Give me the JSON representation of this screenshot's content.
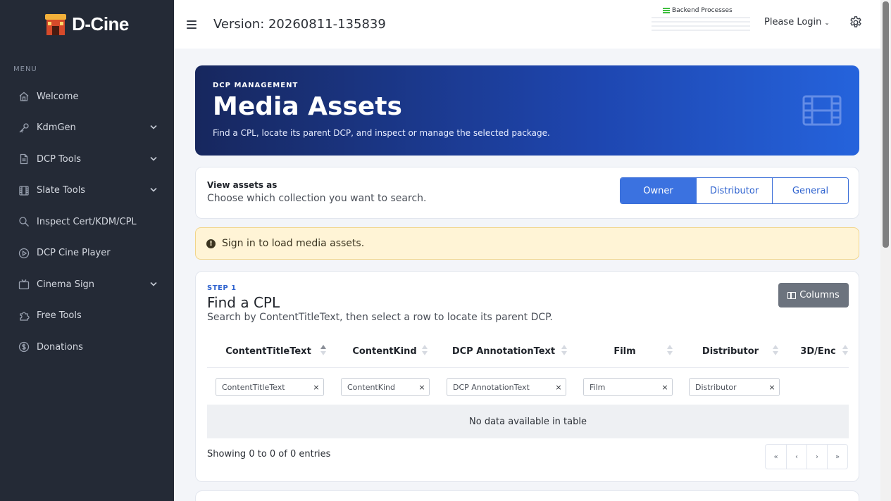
{
  "brand": {
    "name": "D-Cine"
  },
  "sidebar": {
    "menu_label": "MENU",
    "items": [
      {
        "label": "Welcome",
        "icon": "home-icon",
        "has_submenu": false
      },
      {
        "label": "KdmGen",
        "icon": "key-icon",
        "has_submenu": true
      },
      {
        "label": "DCP Tools",
        "icon": "file-icon",
        "has_submenu": true
      },
      {
        "label": "Slate Tools",
        "icon": "film-icon",
        "has_submenu": true
      },
      {
        "label": "Inspect Cert/KDM/CPL",
        "icon": "search-icon",
        "has_submenu": false
      },
      {
        "label": "DCP Cine Player",
        "icon": "play-icon",
        "has_submenu": false
      },
      {
        "label": "Cinema Sign",
        "icon": "tv-icon",
        "has_submenu": true
      },
      {
        "label": "Free Tools",
        "icon": "puzzle-icon",
        "has_submenu": false
      },
      {
        "label": "Donations",
        "icon": "dollar-icon",
        "has_submenu": false
      }
    ]
  },
  "header": {
    "version": "Version: 20260811-135839",
    "backend_label": "Backend Processes",
    "login_label": "Please Login",
    "login_caret": "⌄"
  },
  "hero": {
    "eyebrow": "DCP MANAGEMENT",
    "title": "Media Assets",
    "subtitle": "Find a CPL, locate its parent DCP, and inspect or manage the selected package."
  },
  "view": {
    "heading": "View assets as",
    "description": "Choose which collection you want to search.",
    "options": [
      "Owner",
      "Distributor",
      "General"
    ],
    "selected": "Owner"
  },
  "alert": {
    "icon": "!",
    "text": "Sign in to load media assets."
  },
  "step1": {
    "step_label": "STEP 1",
    "title": "Find a CPL",
    "description": "Search by ContentTitleText, then select a row to locate its parent DCP.",
    "columns_button": "Columns",
    "headers": [
      "ContentTitleText",
      "ContentKind",
      "DCP AnnotationText",
      "Film",
      "Distributor",
      "3D/Enc"
    ],
    "filters": [
      "ContentTitleText",
      "ContentKind",
      "DCP AnnotationText",
      "Film",
      "Distributor"
    ],
    "clear_symbol": "×",
    "empty_message": "No data available in table",
    "info": "Showing 0 to 0 of 0 entries",
    "pager": [
      "«",
      "‹",
      "›",
      "»"
    ]
  },
  "colors": {
    "sidebar_bg": "#242a36",
    "accent": "#3b72e0",
    "hero_start": "#17275e",
    "hero_end": "#2563dc",
    "alert_bg": "#fff4d6"
  }
}
